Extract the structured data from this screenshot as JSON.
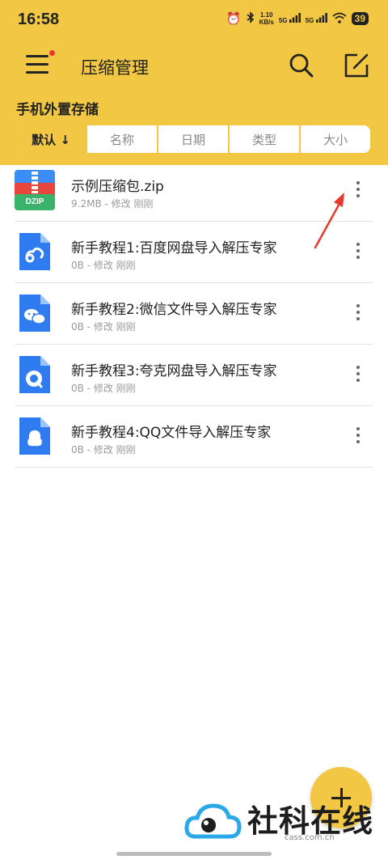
{
  "status_bar": {
    "time": "16:58",
    "net_speed_value": "1.10",
    "net_speed_unit": "KB/s",
    "signal_1": "5G",
    "signal_2": "5G",
    "battery": "39",
    "icons": [
      "alarm-icon",
      "bluetooth-icon",
      "signal-icon",
      "wifi-icon",
      "battery-icon"
    ]
  },
  "app_bar": {
    "title": "压缩管理",
    "icons": [
      "menu-icon",
      "search-icon",
      "edit-icon"
    ]
  },
  "storage_label": "手机外置存储",
  "sort_tabs": [
    {
      "label": "默认 ↓",
      "active": true
    },
    {
      "label": "名称",
      "active": false
    },
    {
      "label": "日期",
      "active": false
    },
    {
      "label": "类型",
      "active": false
    },
    {
      "label": "大小",
      "active": false
    }
  ],
  "files": [
    {
      "name": "示例压缩包.zip",
      "meta": "9.2MB - 修改 刚刚",
      "icon": "zip-file-icon",
      "icon_label": "DZIP"
    },
    {
      "name": "新手教程1:百度网盘导入解压专家",
      "meta": "0B - 修改 刚刚",
      "icon": "baidu-doc-icon"
    },
    {
      "name": "新手教程2:微信文件导入解压专家",
      "meta": "0B - 修改 刚刚",
      "icon": "wechat-doc-icon"
    },
    {
      "name": "新手教程3:夸克网盘导入解压专家",
      "meta": "0B - 修改 刚刚",
      "icon": "quark-doc-icon"
    },
    {
      "name": "新手教程4:QQ文件导入解压专家",
      "meta": "0B - 修改 刚刚",
      "icon": "qq-doc-icon"
    }
  ],
  "watermark": {
    "text": "社科在线",
    "url": "cass.com.cn"
  },
  "colors": {
    "accent": "#F2C744",
    "doc_blue": "#2F7BF0",
    "zip_blue": "#3A8EF5",
    "zip_red": "#E8453C",
    "zip_green": "#3BB26A",
    "annotation_red": "#E5392D"
  }
}
